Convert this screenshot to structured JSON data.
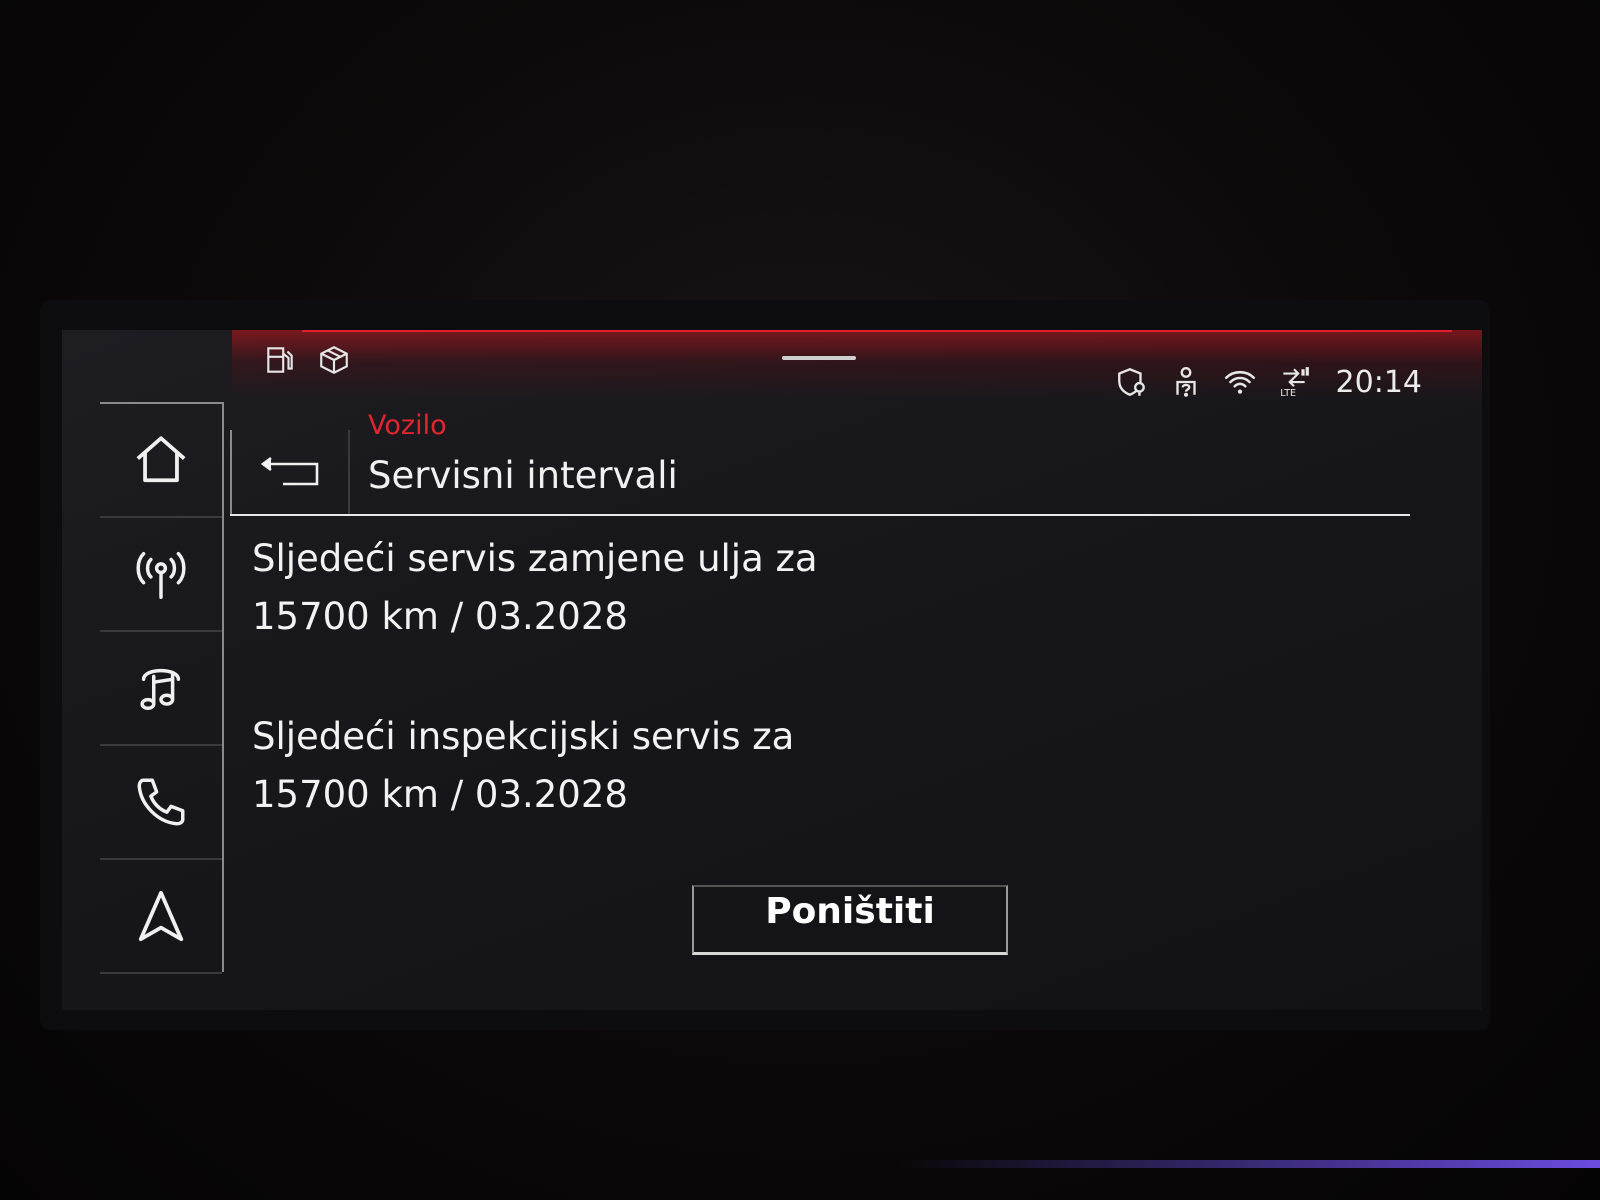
{
  "colors": {
    "accent_red": "#e0202c",
    "text": "#f0f0f0",
    "background": "#18181c"
  },
  "status_bar": {
    "left_icons": [
      "fuel-pump-icon",
      "cube-icon"
    ],
    "right_icons": [
      "shield-location-icon",
      "person-question-icon",
      "wifi-icon",
      "lte-signal-icon"
    ],
    "time": "20:14"
  },
  "sidebar": {
    "items": [
      {
        "icon": "home-icon"
      },
      {
        "icon": "radio-antenna-icon"
      },
      {
        "icon": "music-note-icon"
      },
      {
        "icon": "phone-icon"
      },
      {
        "icon": "navigation-arrow-icon"
      }
    ]
  },
  "header": {
    "breadcrumb": "Vozilo",
    "title": "Servisni intervali"
  },
  "entries": [
    {
      "label": "Sljedeći servis zamjene ulja za",
      "value": "15700 km / 03.2028"
    },
    {
      "label": "Sljedeći inspekcijski servis za",
      "value": "15700 km / 03.2028"
    }
  ],
  "actions": {
    "reset_label": "Poništiti"
  }
}
